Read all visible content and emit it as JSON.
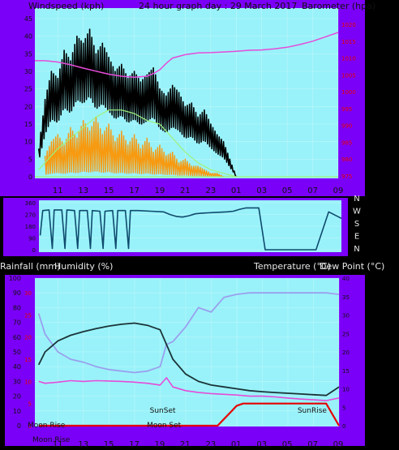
{
  "header": {
    "windspeed_label": "Windspeed (kph)",
    "title": "24 hour graph day : 29 March 2017",
    "barometer_label": "Barometer (hpa)"
  },
  "middle": {
    "rainfall_label": "Rainfall (mm)",
    "humidity_label": "Humidity (%)",
    "temperature_label": "Temperature (°C)",
    "dewpoint_label": "Dew Point (°C)"
  },
  "colors": {
    "frame": "#7B00F7",
    "plot_bg": "#99F2F9",
    "gust": "#000000",
    "wind": "#F79A10",
    "wind_avg": "#9EF27C",
    "barometer": "#E64BD9",
    "direction": "#0F4A6E",
    "temperature": "#1A3438",
    "humidity": "#9AA0EE",
    "dewpoint": "#E64BD9",
    "rain": "#E60000",
    "left_axis_text": "#000000",
    "red_axis_text": "#E60000"
  },
  "chart_data": [
    {
      "type": "line",
      "panel": "wind-barometer",
      "x_ticks": [
        "11",
        "13",
        "15",
        "17",
        "19",
        "21",
        "23",
        "01",
        "03",
        "05",
        "07",
        "09"
      ],
      "y_left_label": "Windspeed (kph)",
      "y_left_ticks": [
        0,
        5,
        10,
        15,
        20,
        25,
        30,
        35,
        40,
        45
      ],
      "ylim_left": [
        0,
        50
      ],
      "y_right_label": "Barometer (hpa)",
      "y_right_ticks": [
        975,
        980,
        985,
        990,
        995,
        1000,
        1005,
        1010,
        1015,
        1020
      ],
      "ylim_right": [
        972.5,
        1022.5
      ],
      "x_start_hour": 9.2,
      "x_end_hour": 33.0,
      "series": [
        {
          "name": "Barometer",
          "axis": "right",
          "x": [
            9.2,
            10,
            11,
            12,
            13,
            14,
            15,
            16,
            17,
            18,
            18.5,
            19,
            19.5,
            20,
            21,
            22,
            23,
            24,
            25,
            26,
            27,
            28,
            29,
            30,
            31,
            32,
            33
          ],
          "values": [
            1009.2,
            1009.2,
            1008.8,
            1008.0,
            1007.0,
            1006.1,
            1005.2,
            1004.6,
            1004.3,
            1004.6,
            1005.4,
            1006.5,
            1008.4,
            1010.0,
            1011.0,
            1011.5,
            1011.6,
            1011.8,
            1012.0,
            1012.3,
            1012.4,
            1012.7,
            1013.2,
            1014.0,
            1015.0,
            1016.3,
            1017.6
          ]
        },
        {
          "name": "Gust",
          "axis": "left",
          "x": [
            9.5,
            10,
            10.5,
            11,
            11.5,
            12,
            12.5,
            13,
            13.5,
            14,
            14.5,
            15,
            15.5,
            16,
            16.5,
            17,
            17.5,
            18,
            18.5,
            19,
            19.5,
            20,
            20.5,
            21,
            21.5,
            22,
            22.5,
            23,
            23.5,
            24,
            24.5,
            25
          ],
          "values": [
            8,
            22,
            30,
            28,
            36,
            33,
            40,
            38,
            42,
            35,
            38,
            34,
            30,
            32,
            28,
            30,
            27,
            29,
            31,
            25,
            23,
            26,
            24,
            20,
            21,
            17,
            19,
            15,
            12,
            10,
            5,
            0
          ]
        },
        {
          "name": "Wind",
          "axis": "left",
          "x": [
            10,
            10.5,
            11,
            11.5,
            12,
            12.5,
            13,
            13.5,
            14,
            14.5,
            15,
            15.5,
            16,
            16.5,
            17,
            17.5,
            18,
            18.5,
            19,
            19.5,
            20,
            20.5,
            21,
            21.5,
            22,
            22.5,
            23,
            23.5,
            24
          ],
          "values": [
            6,
            10,
            12,
            9,
            14,
            11,
            16,
            13,
            17,
            12,
            15,
            10,
            13,
            9,
            12,
            8,
            11,
            7,
            9,
            6,
            7,
            4,
            5,
            3,
            3,
            2,
            1,
            1,
            0
          ]
        },
        {
          "name": "Wind Average",
          "axis": "left",
          "x": [
            9.5,
            10,
            11,
            12,
            13,
            14,
            15,
            16,
            17,
            18,
            19,
            20,
            21,
            22,
            23,
            24,
            25
          ],
          "values": [
            2,
            4,
            8,
            11,
            14,
            17,
            19,
            19,
            18,
            16,
            15,
            11,
            7,
            4,
            2,
            1,
            0
          ]
        }
      ]
    },
    {
      "type": "line",
      "panel": "wind-direction",
      "x_ticks": [
        "11",
        "13",
        "15",
        "17",
        "19",
        "21",
        "23",
        "01",
        "03",
        "05",
        "07",
        "09"
      ],
      "y_left_ticks": [
        0,
        90,
        180,
        270,
        360
      ],
      "ylim_left": [
        0,
        360
      ],
      "y_right_ticks": [
        "N",
        "W",
        "S",
        "E",
        "N"
      ],
      "series": [
        {
          "name": "Wind Direction",
          "x": [
            9.3,
            9.5,
            10,
            11,
            12,
            13,
            14,
            15,
            16,
            17,
            18,
            19,
            19.5,
            20,
            20.5,
            21,
            21.5,
            22,
            23,
            24,
            24.5,
            25,
            25.5,
            26,
            26.5,
            27,
            28,
            29,
            30,
            31,
            32,
            33
          ],
          "values": [
            110,
            300,
            305,
            305,
            300,
            300,
            295,
            300,
            300,
            300,
            295,
            290,
            270,
            255,
            250,
            260,
            275,
            280,
            285,
            290,
            295,
            310,
            320,
            320,
            320,
            0,
            0,
            0,
            0,
            0,
            290,
            240
          ]
        }
      ]
    },
    {
      "type": "line",
      "panel": "rain-humidity-temperature",
      "x_ticks": [
        "11",
        "13",
        "15",
        "17",
        "19",
        "21",
        "23",
        "01",
        "03",
        "05",
        "07",
        "09"
      ],
      "y_left_label": "Humidity (%)",
      "y_left_ticks": [
        0,
        10,
        20,
        30,
        40,
        50,
        60,
        70,
        80,
        90,
        100
      ],
      "ylim_left": [
        0,
        100
      ],
      "y_rain_label": "Rainfall (mm)",
      "y_rain_ticks": [
        0,
        5,
        10,
        15,
        20,
        25,
        30
      ],
      "ylim_rain": [
        0,
        33.3
      ],
      "y_right_label": "Temperature (°C)",
      "y_right_ticks": [
        0,
        5,
        10,
        15,
        20,
        25,
        30,
        35,
        40
      ],
      "ylim_right": [
        0,
        40
      ],
      "annotations": [
        "Moon Rise",
        "SunSet",
        "Moon Set",
        "SunRise",
        "Moon Rise"
      ],
      "series": [
        {
          "name": "Temperature",
          "axis": "right",
          "x": [
            9.5,
            10,
            11,
            12,
            13,
            14,
            15,
            16,
            17,
            18,
            19,
            20,
            21,
            22,
            23,
            24,
            25,
            26,
            27,
            28,
            29,
            30,
            31,
            32,
            33
          ],
          "values": [
            16.5,
            20,
            23,
            24.5,
            25.5,
            26.3,
            27,
            27.5,
            27.8,
            27.2,
            26,
            18,
            14,
            12,
            11,
            10.5,
            10,
            9.5,
            9.2,
            9,
            8.8,
            8.6,
            8.4,
            8.2,
            10.5
          ]
        },
        {
          "name": "Humidity",
          "axis": "left",
          "x": [
            9.5,
            10,
            11,
            12,
            13,
            14,
            15,
            16,
            17,
            18,
            19,
            19.5,
            20,
            21,
            22,
            23,
            24,
            25,
            26,
            27,
            28,
            29,
            30,
            31,
            32,
            33
          ],
          "values": [
            76,
            62,
            50,
            45,
            43,
            40,
            38,
            37,
            36,
            37,
            40,
            55,
            57,
            67,
            80,
            77,
            87,
            89,
            90,
            90,
            90,
            90,
            90,
            90,
            90,
            89
          ]
        },
        {
          "name": "Dew Point",
          "axis": "right",
          "x": [
            9.5,
            10,
            11,
            12,
            13,
            14,
            15,
            16,
            17,
            18,
            19,
            19.5,
            20,
            21,
            22,
            23,
            24,
            25,
            26,
            27,
            28,
            29,
            30,
            31,
            32,
            33
          ],
          "values": [
            12,
            11.5,
            11.8,
            12.2,
            12,
            12.2,
            12.1,
            12,
            11.8,
            11.5,
            11,
            13,
            10.5,
            9.5,
            9,
            8.7,
            8.5,
            8.3,
            8,
            8,
            7.8,
            7.5,
            7.2,
            7,
            6.8,
            7.5
          ]
        },
        {
          "name": "Rainfall",
          "axis": "rain",
          "x": [
            9.5,
            23.5,
            24,
            24.5,
            25,
            25.5,
            26,
            27,
            28,
            29,
            30,
            31,
            32,
            33
          ],
          "values": [
            0,
            0,
            1.5,
            3,
            4.5,
            5,
            5,
            5,
            5,
            5,
            5,
            5,
            5,
            0
          ]
        }
      ]
    }
  ]
}
